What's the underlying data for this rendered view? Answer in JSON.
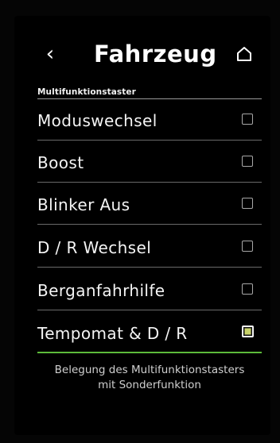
{
  "header": {
    "back_glyph": "‹",
    "title": "Fahrzeug",
    "home_icon": "home-icon"
  },
  "section": {
    "label": "Multifunktionstaster"
  },
  "options": [
    {
      "label": "Moduswechsel",
      "checked": false
    },
    {
      "label": "Boost",
      "checked": false
    },
    {
      "label": "Blinker Aus",
      "checked": false
    },
    {
      "label": "D / R Wechsel",
      "checked": false
    },
    {
      "label": "Berganfahrhilfe",
      "checked": false
    },
    {
      "label": "Tempomat & D / R",
      "checked": true
    }
  ],
  "description": {
    "line1": "Belegung des Multifunktionstasters",
    "line2": "mit Sonderfunktion"
  },
  "colors": {
    "background": "#000000",
    "text": "#f4f4f4",
    "active_underline": "#5dbb3a",
    "checked_fill": "#c9d36a"
  }
}
